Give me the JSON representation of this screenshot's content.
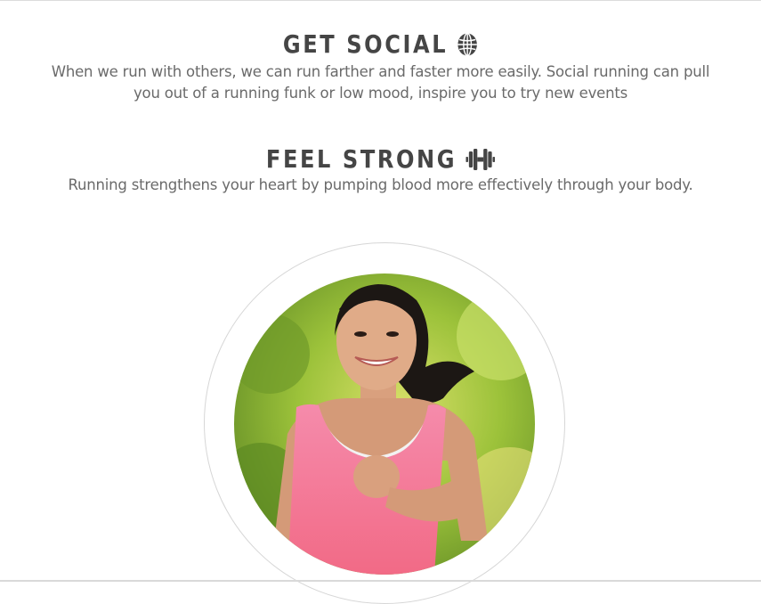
{
  "sections": [
    {
      "heading": "GET SOCIAL",
      "icon": "globe-icon",
      "text": "When we run with others, we can run farther and faster more easily. Social running can pull you out of a running funk or low mood, inspire you to try new events"
    },
    {
      "heading": "FEEL STRONG",
      "icon": "dumbbell-icon",
      "text": "Running strengthens your heart by pumping blood more effectively through your body."
    }
  ],
  "colors": {
    "heading": "#454545",
    "body_text": "#6a6a6a",
    "ring": "#d6d6d6"
  }
}
